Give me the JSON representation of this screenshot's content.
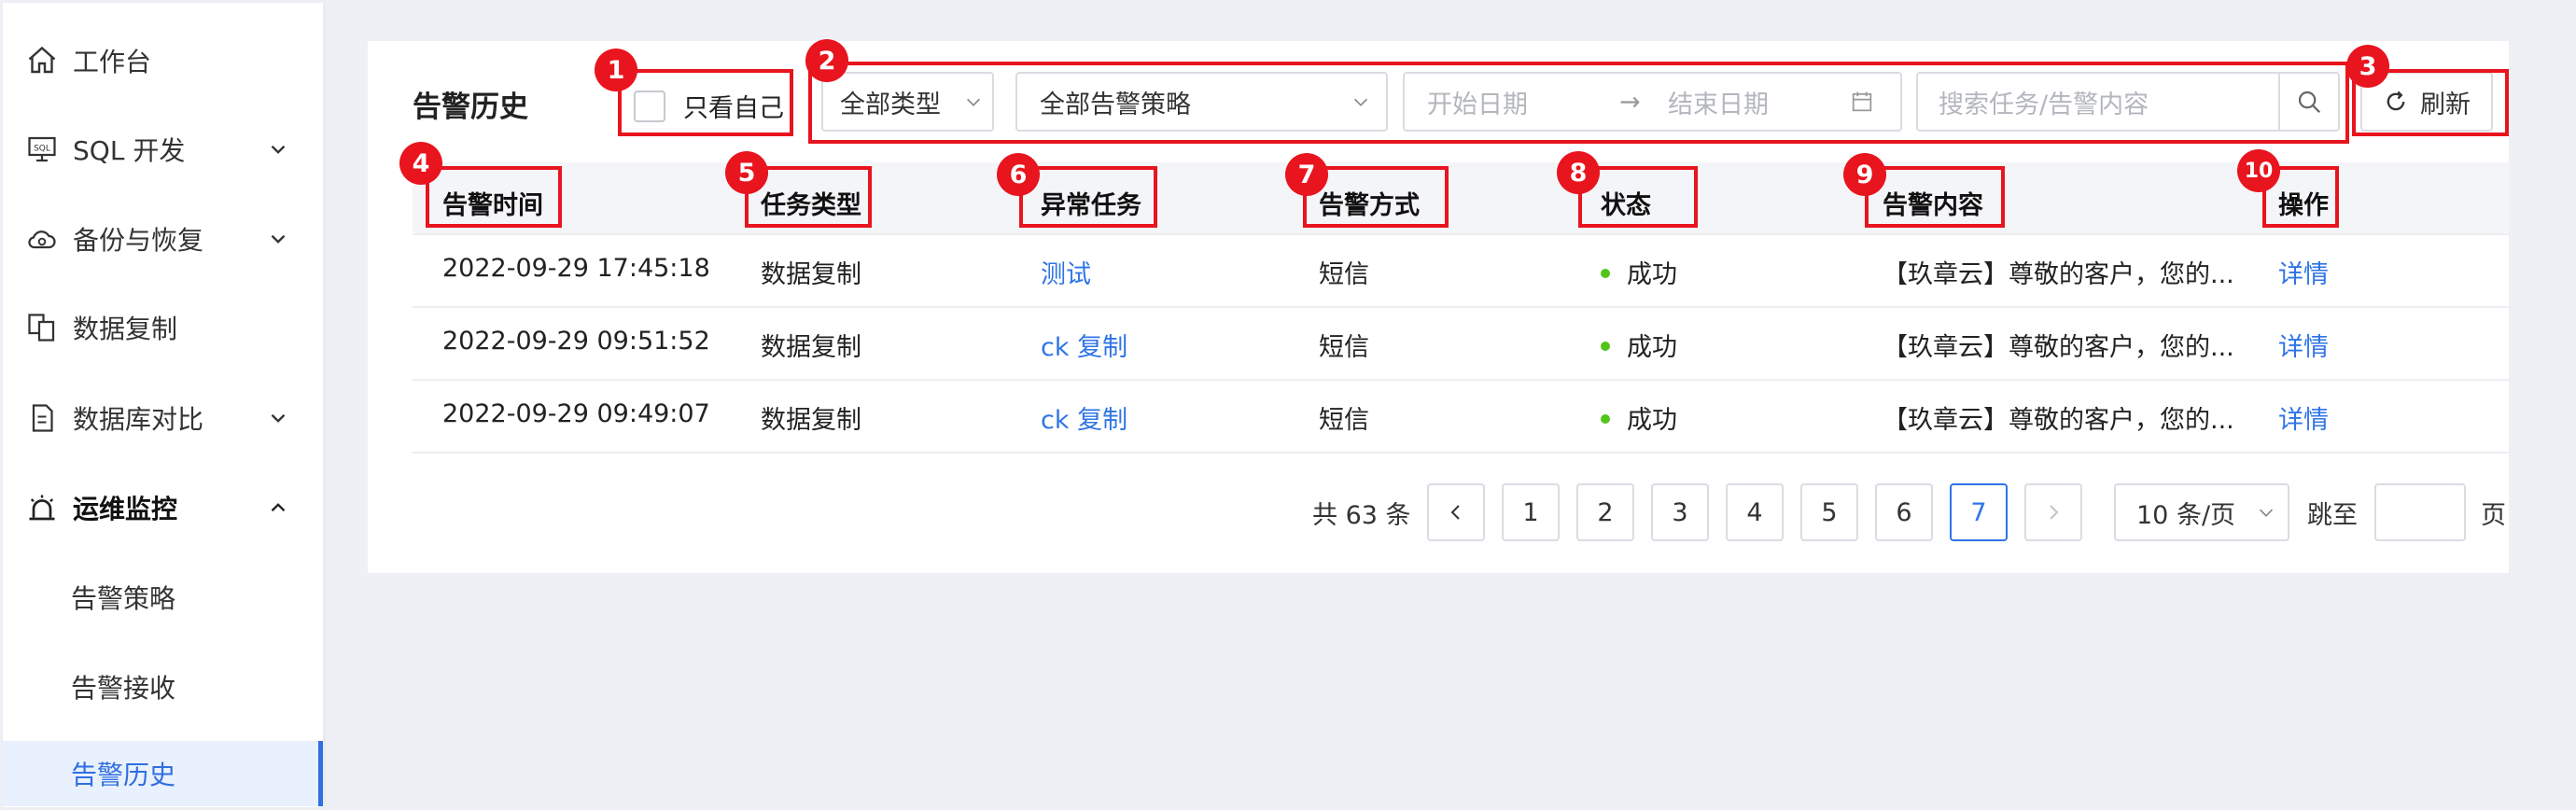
{
  "sidebar": {
    "items": [
      {
        "label": "工作台",
        "icon": "home-icon"
      },
      {
        "label": "SQL 开发",
        "icon": "sql-icon"
      },
      {
        "label": "备份与恢复",
        "icon": "cloud-backup-icon"
      },
      {
        "label": "数据复制",
        "icon": "copy-icon"
      },
      {
        "label": "数据库对比",
        "icon": "compare-icon"
      },
      {
        "label": "运维监控",
        "icon": "alarm-icon"
      }
    ],
    "sub_items": [
      {
        "label": "告警策略"
      },
      {
        "label": "告警接收"
      },
      {
        "label": "告警历史"
      }
    ]
  },
  "page": {
    "title": "告警历史",
    "only_mine_label": "只看自己",
    "type_select": "全部类型",
    "policy_select": "全部告警策略",
    "start_date_placeholder": "开始日期",
    "end_date_placeholder": "结束日期",
    "date_separator": "→",
    "search_placeholder": "搜索任务/告警内容",
    "refresh_label": "刷新"
  },
  "badges": [
    "1",
    "2",
    "3",
    "4",
    "5",
    "6",
    "7",
    "8",
    "9",
    "10"
  ],
  "table": {
    "columns": [
      "告警时间",
      "任务类型",
      "异常任务",
      "告警方式",
      "状态",
      "告警内容",
      "操作"
    ],
    "rows": [
      {
        "time": "2022-09-29 17:45:18",
        "type": "数据复制",
        "task": "测试",
        "method": "短信",
        "status": "成功",
        "content": "【玖章云】尊敬的客户，您的...",
        "action": "详情"
      },
      {
        "time": "2022-09-29 09:51:52",
        "type": "数据复制",
        "task": "ck 复制",
        "method": "短信",
        "status": "成功",
        "content": "【玖章云】尊敬的客户，您的...",
        "action": "详情"
      },
      {
        "time": "2022-09-29 09:49:07",
        "type": "数据复制",
        "task": "ck 复制",
        "method": "短信",
        "status": "成功",
        "content": "【玖章云】尊敬的客户，您的...",
        "action": "详情"
      }
    ]
  },
  "pagination": {
    "total_text": "共 63 条",
    "prev": "<",
    "next": ">",
    "pages": [
      "1",
      "2",
      "3",
      "4",
      "5",
      "6",
      "7"
    ],
    "current_page": "7",
    "page_size": "10 条/页",
    "jump_label": "跳至",
    "page_unit": "页"
  },
  "colors": {
    "accent": "#2f74e6",
    "annotation_red": "#e8141e",
    "status_success": "#52c41a"
  }
}
